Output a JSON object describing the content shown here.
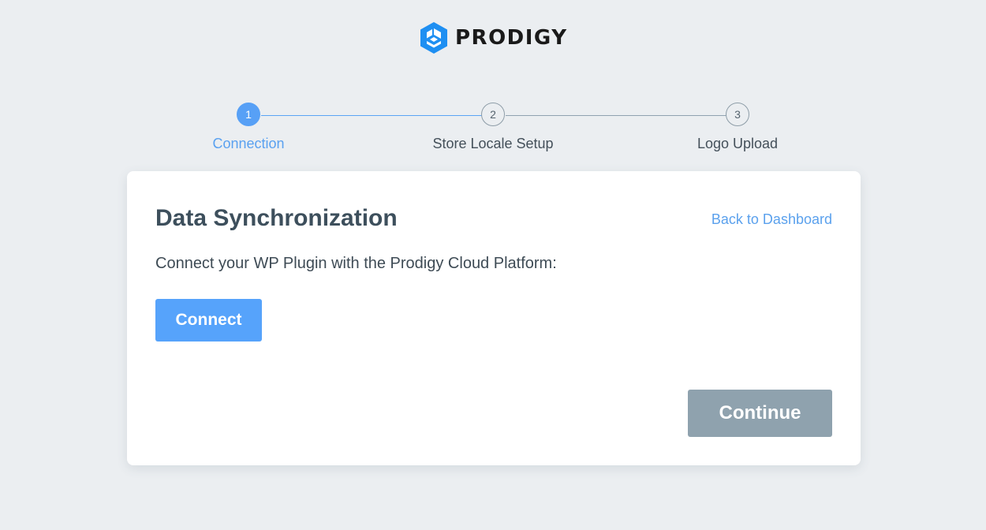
{
  "brand": {
    "name": "PRODIGY",
    "logo_icon": "prodigy-cube-logo",
    "logo_color": "#1e8ff2"
  },
  "stepper": {
    "accent_color": "#57a0f6",
    "current_step": 1,
    "steps": [
      {
        "number": "1",
        "label": "Connection",
        "state": "active"
      },
      {
        "number": "2",
        "label": "Store Locale Setup",
        "state": "inactive"
      },
      {
        "number": "3",
        "label": "Logo Upload",
        "state": "inactive"
      }
    ]
  },
  "card": {
    "title": "Data Synchronization",
    "back_link": "Back to Dashboard",
    "description": "Connect your WP Plugin with the Prodigy Cloud Platform:",
    "connect_label": "Connect",
    "continue_label": "Continue",
    "connect_color": "#56a3fb",
    "continue_color": "#8fa2ae"
  }
}
